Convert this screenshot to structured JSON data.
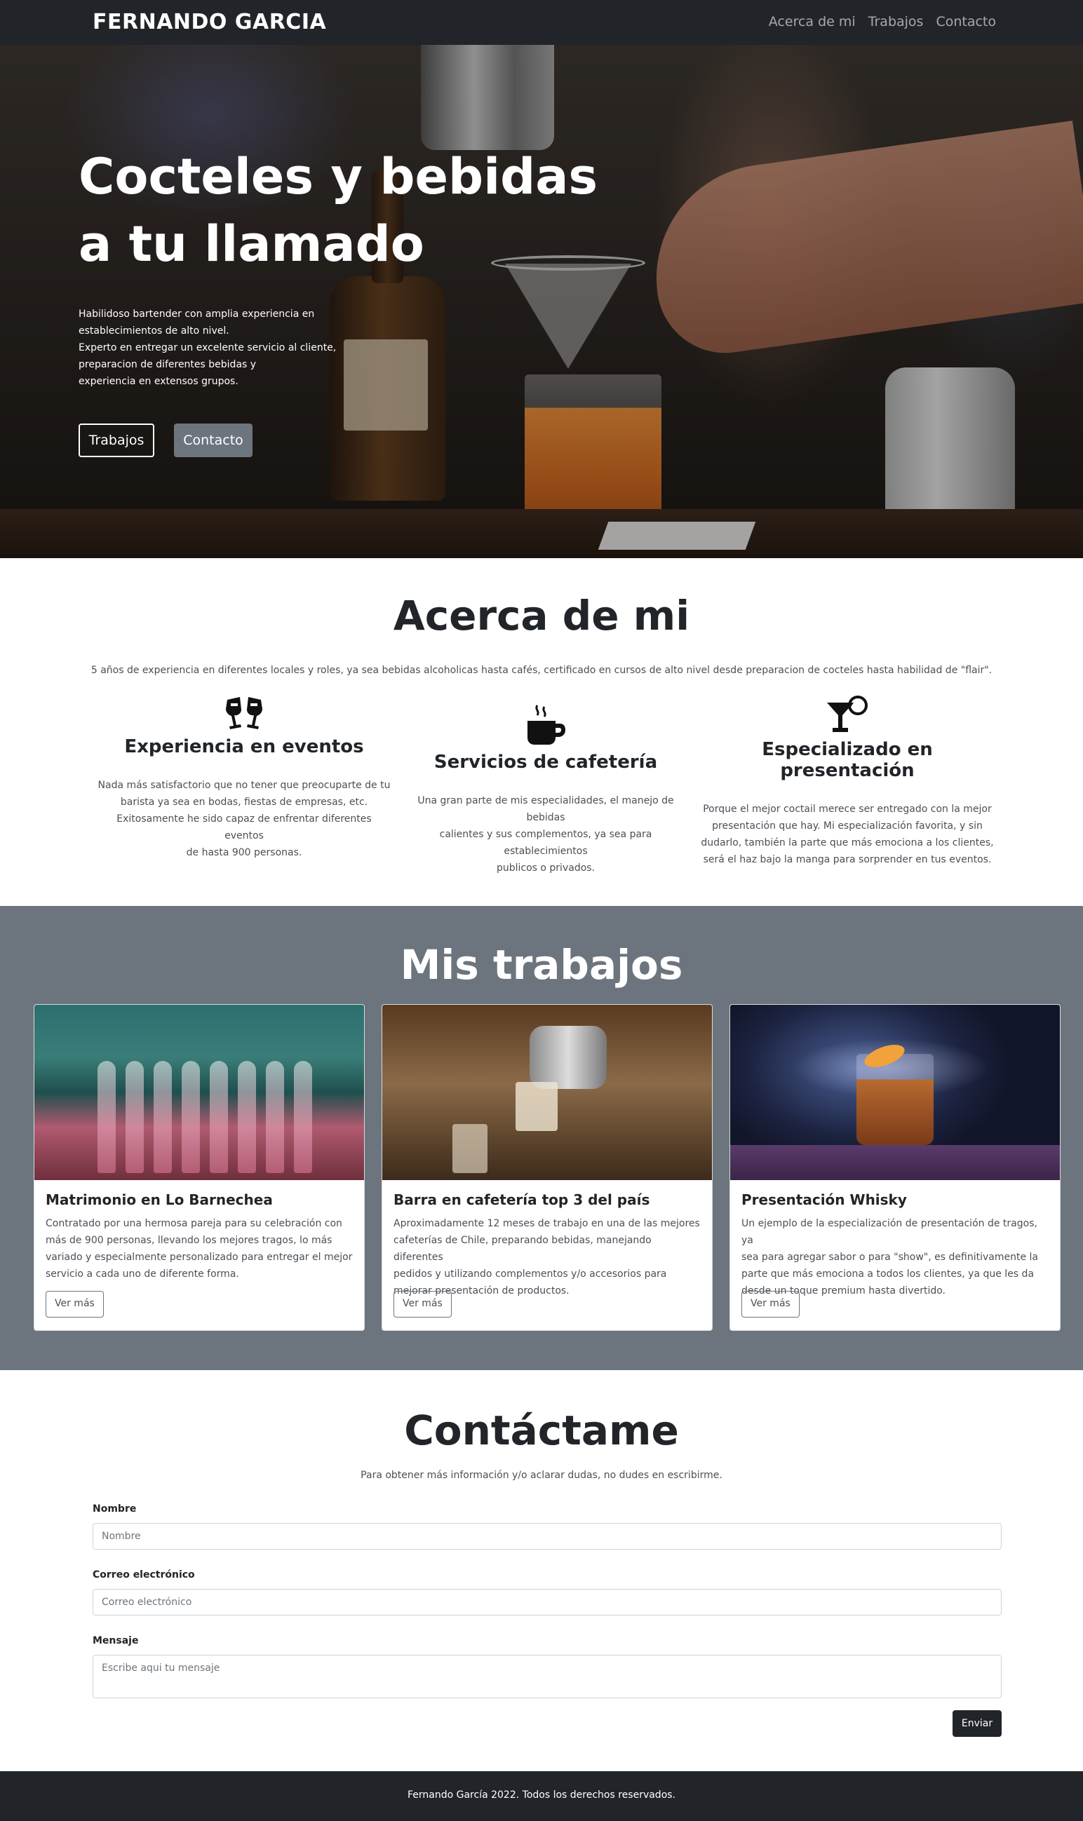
{
  "navbar": {
    "brand": "FERNANDO GARCIA",
    "links": [
      "Acerca de mi",
      "Trabajos",
      "Contacto"
    ]
  },
  "hero": {
    "title_lines": [
      "Cocteles y bebidas",
      "a tu llamado"
    ],
    "text_lines": [
      "Habilidoso bartender con amplia experiencia en",
      "establecimientos de alto nivel.",
      "Experto en entregar un excelente servicio al cliente,",
      "preparacion de diferentes bebidas y",
      "experiencia en extensos grupos."
    ],
    "buttons": [
      "Trabajos",
      "Contacto"
    ]
  },
  "about": {
    "title": "Acerca de mi",
    "lead": "5 años de experiencia en diferentes locales y roles, ya sea bebidas alcoholicas hasta cafés, certificado en cursos de alto nivel desde preparacion de cocteles hasta habilidad de \"flair\".",
    "features": [
      {
        "icon": "glass-cheers-icon",
        "title": "Experiencia en eventos",
        "lines": [
          "Nada más satisfactorio que no tener que preocuparte de tu",
          "barista ya sea en bodas, fiestas de empresas, etc.",
          "Exitosamente he sido capaz de enfrentar diferentes eventos",
          "de hasta 900 personas."
        ]
      },
      {
        "icon": "mug-hot-icon",
        "title": "Servicios de cafetería",
        "lines": [
          "Una gran parte de mis especialidades, el manejo de bebidas",
          "calientes y sus complementos, ya sea para establecimientos",
          "publicos o privados."
        ]
      },
      {
        "icon": "cocktail-icon",
        "title": "Especializado en presentación",
        "lines": [
          "Porque el mejor coctail merece ser entregado con la mejor",
          "presentación que hay. Mi especialización favorita, y sin",
          "dudarlo, también la parte que más emociona a los clientes,",
          "será el haz bajo la manga para sorprender en tus eventos."
        ]
      }
    ]
  },
  "works": {
    "title": "Mis trabajos",
    "cards": [
      {
        "title": "Matrimonio en Lo Barnechea",
        "lines": [
          "Contratado por una hermosa pareja para su celebración con",
          "más de 900 personas, llevando los mejores tragos, lo más",
          "variado y especialmente personalizado para entregar el mejor",
          "servicio a cada uno de diferente forma."
        ],
        "button": "Ver más"
      },
      {
        "title": "Barra en cafetería top 3 del país",
        "lines": [
          "Aproximadamente 12 meses de trabajo en una de las mejores",
          "cafeterías de Chile, preparando bebidas, manejando diferentes",
          "pedidos y utilizando complementos y/o accesorios para",
          "mejorar presentación de productos."
        ],
        "button": "Ver más"
      },
      {
        "title": "Presentación Whisky",
        "lines": [
          "Un ejemplo de la especialización de presentación de tragos, ya",
          "sea para agregar sabor o para \"show\", es definitivamente la",
          "parte que más emociona a todos los clientes, ya que les da",
          "desde un toque premium hasta divertido."
        ],
        "button": "Ver más"
      }
    ]
  },
  "contact": {
    "title": "Contáctame",
    "lead": "Para obtener más información y/o aclarar dudas, no dudes en escribirme.",
    "fields": [
      {
        "label": "Nombre",
        "placeholder": "Nombre"
      },
      {
        "label": "Correo electrónico",
        "placeholder": "Correo electrónico"
      },
      {
        "label": "Mensaje",
        "placeholder": "Escribe aqui tu mensaje"
      }
    ],
    "submit": "Enviar"
  },
  "footer": {
    "text": "Fernando García 2022. Todos los derechos reservados."
  }
}
